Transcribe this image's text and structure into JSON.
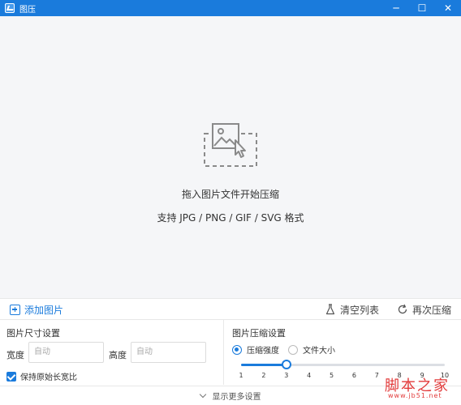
{
  "window": {
    "title": "图压",
    "controls": {
      "minimize": "─",
      "maximize": "☐",
      "close": "✕"
    }
  },
  "dropzone": {
    "icon": "image-drop-icon",
    "primary_text": "拖入图片文件开始压缩",
    "secondary_text": "支持 JPG / PNG / GIF / SVG 格式"
  },
  "toolbar": {
    "add_label": "添加图片",
    "clear_label": "清空列表",
    "redo_label": "再次压缩"
  },
  "size_settings": {
    "title": "图片尺寸设置",
    "width_label": "宽度",
    "width_placeholder": "自动",
    "height_label": "高度",
    "height_placeholder": "自动",
    "keep_ratio_label": "保持原始长宽比",
    "keep_ratio_checked": true
  },
  "compress_settings": {
    "title": "图片压缩设置",
    "mode_strength": "压缩强度",
    "mode_filesize": "文件大小",
    "selected_mode": "压缩强度",
    "level_value": 3,
    "level_min": 1,
    "level_max": 10,
    "ticks": [
      "1",
      "2",
      "3",
      "4",
      "5",
      "6",
      "7",
      "8",
      "9",
      "10"
    ]
  },
  "footer": {
    "more_label": "显示更多设置"
  },
  "watermark": {
    "text": "脚本之家",
    "url": "www.jb51.net"
  },
  "colors": {
    "accent": "#1a7bdc",
    "watermark": "#e23b3b"
  }
}
